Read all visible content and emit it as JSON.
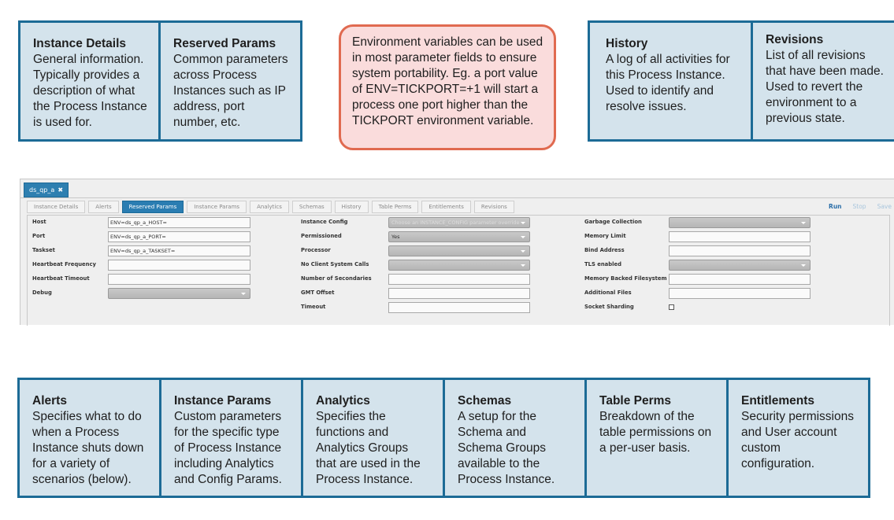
{
  "top_callouts_left": [
    {
      "title": "Instance Details",
      "body": "General information. Typically provides a description of what the Process Instance is used for."
    },
    {
      "title": "Reserved Params",
      "body": "Common parameters across Process Instances such as IP address, port number, etc."
    }
  ],
  "note": {
    "text": "Environment variables can be used in most parameter fields to ensure system portability. Eg. a port value of ENV=TICKPORT=+1 will start a process one port higher than the TICKPORT environment variable."
  },
  "top_callouts_right": [
    {
      "title": "History",
      "body": "A log of all activities for this Process Instance. Used to identify and resolve issues."
    },
    {
      "title": "Revisions",
      "body": "List of all revisions that have been made. Used to revert the environment to a previous state."
    }
  ],
  "app": {
    "doc_tab": {
      "label": "ds_qp_a",
      "close": "✖"
    },
    "tabs": [
      {
        "label": "Instance Details",
        "active": false
      },
      {
        "label": "Alerts",
        "active": false
      },
      {
        "label": "Reserved Params",
        "active": true
      },
      {
        "label": "Instance Params",
        "active": false
      },
      {
        "label": "Analytics",
        "active": false
      },
      {
        "label": "Schemas",
        "active": false
      },
      {
        "label": "History",
        "active": false
      },
      {
        "label": "Table Perms",
        "active": false
      },
      {
        "label": "Entitlements",
        "active": false
      },
      {
        "label": "Revisions",
        "active": false
      }
    ],
    "actions": {
      "run": "Run",
      "stop": "Stop",
      "save": "Save"
    },
    "col1": [
      {
        "label": "Host",
        "type": "input",
        "value": "ENV=ds_qp_a_HOST="
      },
      {
        "label": "Port",
        "type": "input",
        "value": "ENV=ds_qp_a_PORT="
      },
      {
        "label": "Taskset",
        "type": "input",
        "value": "ENV=ds_qp_a_TASKSET="
      },
      {
        "label": "Heartbeat Frequency",
        "type": "input",
        "value": ""
      },
      {
        "label": "Heartbeat Timeout",
        "type": "input",
        "value": ""
      },
      {
        "label": "Debug",
        "type": "select",
        "value": ""
      }
    ],
    "col2": [
      {
        "label": "Instance Config",
        "type": "select",
        "value": "",
        "placeholder": "Choose an INSTANCE_CONFIG parameter override"
      },
      {
        "label": "Permissioned",
        "type": "select",
        "value": "Yes"
      },
      {
        "label": "Processor",
        "type": "select",
        "value": ""
      },
      {
        "label": "No Client System Calls",
        "type": "select",
        "value": ""
      },
      {
        "label": "Number of Secondaries",
        "type": "input",
        "value": ""
      },
      {
        "label": "GMT Offset",
        "type": "input",
        "value": ""
      },
      {
        "label": "Timeout",
        "type": "input",
        "value": ""
      }
    ],
    "col3": [
      {
        "label": "Garbage Collection",
        "type": "select",
        "value": ""
      },
      {
        "label": "Memory Limit",
        "type": "input",
        "value": ""
      },
      {
        "label": "Bind Address",
        "type": "input",
        "value": ""
      },
      {
        "label": "TLS enabled",
        "type": "select",
        "value": ""
      },
      {
        "label": "Memory Backed Filesystem",
        "type": "input",
        "value": ""
      },
      {
        "label": "Additional Files",
        "type": "input",
        "value": ""
      },
      {
        "label": "Socket Sharding",
        "type": "checkbox",
        "checked": false
      }
    ]
  },
  "bottom_callouts": [
    {
      "title": "Alerts",
      "body": "Specifies what to do when a Process Instance shuts down for a variety of scenarios (below)."
    },
    {
      "title": "Instance Params",
      "body": "Custom parameters for the specific type of Process Instance including Analytics and Config Params."
    },
    {
      "title": "Analytics",
      "body": "Specifies the functions and Analytics Groups that are used in the Process Instance."
    },
    {
      "title": "Schemas",
      "body": "A setup for the Schema and Schema Groups available to the Process Instance."
    },
    {
      "title": "Table Perms",
      "body": "Breakdown of the table permissions on a per-user basis."
    },
    {
      "title": "Entitlements",
      "body": "Security permissions and User account custom configuration."
    }
  ],
  "colors": {
    "callout_bg": "#d4e3ec",
    "callout_border": "#1c6b96",
    "note_bg": "#fadcdc",
    "note_border": "#e06a50",
    "active_tab": "#2a7db2"
  }
}
